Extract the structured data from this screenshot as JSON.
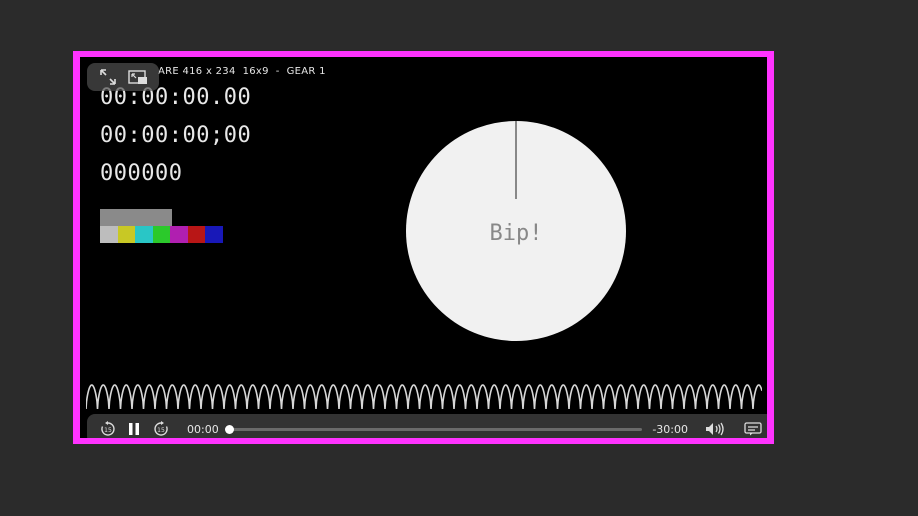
{
  "header": {
    "source_line": "ARE 416 x 234  16x9  -  GEAR 1"
  },
  "timecodes": {
    "line1": "00:00:00.00",
    "line2": "00:00:00;00",
    "line3": "000000"
  },
  "dial": {
    "label": "Bip!"
  },
  "color_bars": {
    "top": [
      "#8a8a8a",
      "#8a8a8a",
      "#8a8a8a",
      "#8a8a8a"
    ],
    "bottom": [
      "#bdbdbd",
      "#c8c825",
      "#29c6c6",
      "#2bc92b",
      "#b01fb0",
      "#b81616",
      "#1818b8"
    ]
  },
  "player": {
    "frame_color": "#ff33ff",
    "elapsed": "00:00",
    "remaining": "-30:00",
    "progress": 0.0,
    "icons": {
      "fullscreen": "expand-icon",
      "pip": "picture-in-picture-icon",
      "skip_back": "skip-back-15-icon",
      "pause": "pause-icon",
      "skip_forward": "skip-forward-15-icon",
      "volume": "volume-icon",
      "captions": "captions-icon"
    },
    "skip_seconds": "15"
  }
}
